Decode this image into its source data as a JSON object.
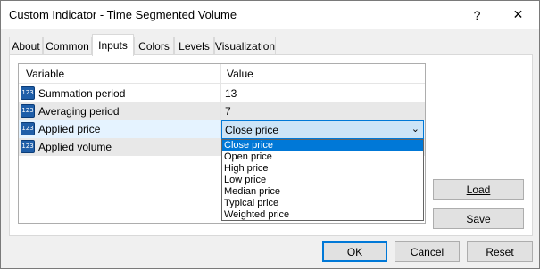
{
  "window": {
    "title": "Custom Indicator - Time Segmented Volume",
    "help": "?",
    "close": "✕"
  },
  "tabs": [
    {
      "label": "About",
      "active": false
    },
    {
      "label": "Common",
      "active": false
    },
    {
      "label": "Inputs",
      "active": true
    },
    {
      "label": "Colors",
      "active": false
    },
    {
      "label": "Levels",
      "active": false
    },
    {
      "label": "Visualization",
      "active": false
    }
  ],
  "grid": {
    "headers": {
      "variable": "Variable",
      "value": "Value"
    },
    "icon": "123",
    "rows": [
      {
        "label": "Summation period",
        "value": "13"
      },
      {
        "label": "Averaging period",
        "value": "7"
      },
      {
        "label": "Applied price",
        "value": "Close price"
      },
      {
        "label": "Applied volume",
        "value": ""
      }
    ]
  },
  "combo": {
    "value": "Close price",
    "arrow": "⌄"
  },
  "dropdown": {
    "options": [
      "Close price",
      "Open price",
      "High price",
      "Low price",
      "Median price",
      "Typical price",
      "Weighted price"
    ],
    "selected": "Close price"
  },
  "buttons": {
    "load": "Load",
    "save": "Save",
    "ok": "OK",
    "cancel": "Cancel",
    "reset": "Reset"
  },
  "colors": {
    "accent": "#0078d7",
    "icon": "#1f5ea8"
  }
}
